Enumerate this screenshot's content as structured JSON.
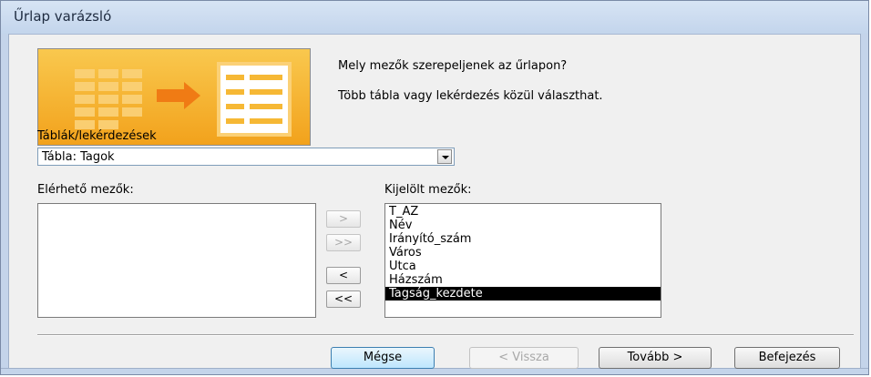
{
  "window": {
    "title": "Űrlap varázsló"
  },
  "header": {
    "question": "Mely mezők szerepeljenek az űrlapon?",
    "hint": "Több tábla vagy lekérdezés közül választhat."
  },
  "source": {
    "label": "Táblák/lekérdezések",
    "selected": "Tábla: Tagok"
  },
  "available_fields": {
    "label": "Elérhető mezők:",
    "items": []
  },
  "selected_fields": {
    "label": "Kijelölt mezők:",
    "items": [
      "T_AZ",
      "Név",
      "Irányító_szám",
      "Város",
      "Utca",
      "Házszám",
      "Tagság_kezdete"
    ],
    "highlighted": "Tagság_kezdete"
  },
  "move_buttons": {
    "add_one": ">",
    "add_all": ">>",
    "remove_one": "<",
    "remove_all": "<<"
  },
  "footer": {
    "cancel": "Mégse",
    "back": "< Vissza",
    "next": "Tovább >",
    "finish": "Befejezés"
  }
}
